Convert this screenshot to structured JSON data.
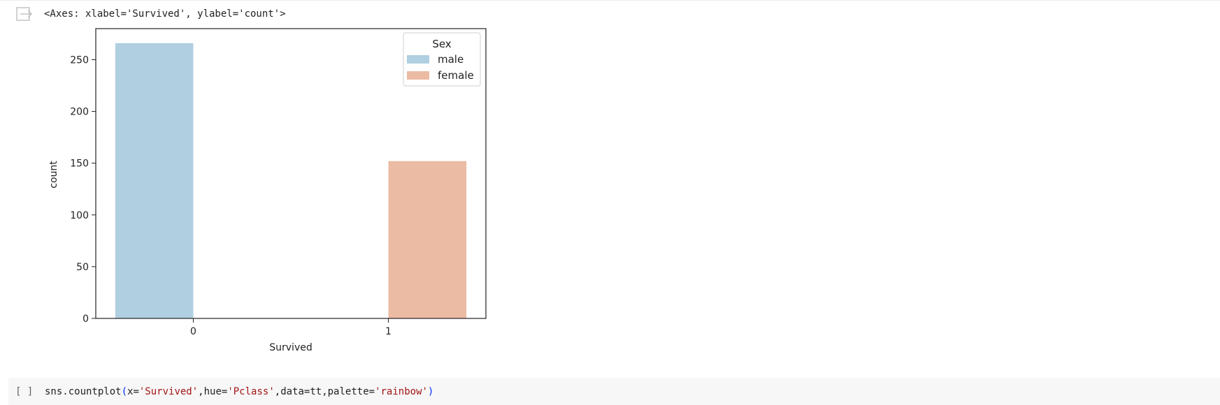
{
  "output": {
    "repr_text": "<Axes: xlabel='Survived', ylabel='count'>"
  },
  "chart_data": {
    "type": "bar",
    "categories": [
      "0",
      "1"
    ],
    "series": [
      {
        "name": "male",
        "values": [
          266,
          0
        ],
        "color": "#b0cfe0"
      },
      {
        "name": "female",
        "values": [
          0,
          152
        ],
        "color": "#ebbba4"
      }
    ],
    "xlabel": "Survived",
    "ylabel": "count",
    "ylim": [
      0,
      280
    ],
    "yticks": [
      0,
      50,
      100,
      150,
      200,
      250
    ],
    "grid": false,
    "legend": {
      "title": "Sex",
      "placement": "top-right"
    }
  },
  "next_cell": {
    "prompt": "[ ]",
    "code_tokens": [
      {
        "text": "sns.countplot",
        "kind": "plain"
      },
      {
        "text": "(",
        "kind": "paren"
      },
      {
        "text": "x=",
        "kind": "plain"
      },
      {
        "text": "'Survived'",
        "kind": "str"
      },
      {
        "text": ",hue=",
        "kind": "plain"
      },
      {
        "text": "'Pclass'",
        "kind": "str"
      },
      {
        "text": ",data=tt,palette=",
        "kind": "plain"
      },
      {
        "text": "'rainbow'",
        "kind": "str"
      },
      {
        "text": ")",
        "kind": "paren"
      }
    ]
  }
}
